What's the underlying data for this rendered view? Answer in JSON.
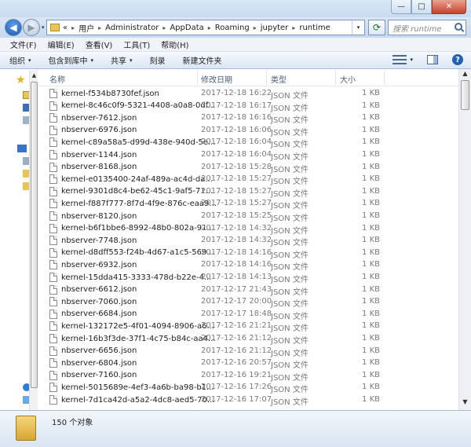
{
  "window": {
    "title": "",
    "min_glyph": "—",
    "max_glyph": "□",
    "close_glyph": "✕"
  },
  "nav": {
    "back_glyph": "◀",
    "forward_glyph": "▶",
    "history_glyph": "▾",
    "refresh_glyph": "⟳",
    "breadcrumbs": [
      "«",
      "用户",
      "Administrator",
      "AppData",
      "Roaming",
      "jupyter",
      "runtime"
    ],
    "separator": "▸",
    "search_placeholder": "搜索 runtime"
  },
  "menu": [
    "文件(F)",
    "编辑(E)",
    "查看(V)",
    "工具(T)",
    "帮助(H)"
  ],
  "toolbar": {
    "items": [
      {
        "label": "组织",
        "dropdown": true
      },
      {
        "label": "包含到库中",
        "dropdown": true
      },
      {
        "label": "共享",
        "dropdown": true
      },
      {
        "label": "刻录",
        "dropdown": false
      },
      {
        "label": "新建文件夹",
        "dropdown": false
      }
    ],
    "dropdown_glyph": "▾",
    "help_glyph": "?"
  },
  "columns": [
    "名称",
    "修改日期",
    "类型",
    "大小"
  ],
  "files": [
    {
      "name": "kernel-f534b8730fef.json",
      "date": "2017-12-18 16:22",
      "type": "JSON 文件",
      "size": "1 KB"
    },
    {
      "name": "kernel-8c46c0f9-5321-4408-a0a8-0df...",
      "date": "2017-12-18 16:17",
      "type": "JSON 文件",
      "size": "1 KB"
    },
    {
      "name": "nbserver-7612.json",
      "date": "2017-12-18 16:16",
      "type": "JSON 文件",
      "size": "1 KB"
    },
    {
      "name": "nbserver-6976.json",
      "date": "2017-12-18 16:06",
      "type": "JSON 文件",
      "size": "1 KB"
    },
    {
      "name": "kernel-c89a58a5-d99d-438e-940d-5e...",
      "date": "2017-12-18 16:04",
      "type": "JSON 文件",
      "size": "1 KB"
    },
    {
      "name": "nbserver-1144.json",
      "date": "2017-12-18 16:04",
      "type": "JSON 文件",
      "size": "1 KB"
    },
    {
      "name": "nbserver-8168.json",
      "date": "2017-12-18 15:28",
      "type": "JSON 文件",
      "size": "1 KB"
    },
    {
      "name": "kernel-e0135400-24af-489a-ac4d-da...",
      "date": "2017-12-18 15:27",
      "type": "JSON 文件",
      "size": "1 KB"
    },
    {
      "name": "kernel-9301d8c4-be62-45c1-9af5-71...",
      "date": "2017-12-18 15:27",
      "type": "JSON 文件",
      "size": "1 KB"
    },
    {
      "name": "kernel-f887f777-8f7d-4f9e-876c-eaa9...",
      "date": "2017-12-18 15:27",
      "type": "JSON 文件",
      "size": "1 KB"
    },
    {
      "name": "nbserver-8120.json",
      "date": "2017-12-18 15:25",
      "type": "JSON 文件",
      "size": "1 KB"
    },
    {
      "name": "kernel-b6f1bbe6-8992-48b0-802a-91...",
      "date": "2017-12-18 14:32",
      "type": "JSON 文件",
      "size": "1 KB"
    },
    {
      "name": "nbserver-7748.json",
      "date": "2017-12-18 14:32",
      "type": "JSON 文件",
      "size": "1 KB"
    },
    {
      "name": "kernel-d8dff553-f24b-4d67-a1c5-569...",
      "date": "2017-12-18 14:16",
      "type": "JSON 文件",
      "size": "1 KB"
    },
    {
      "name": "nbserver-6932.json",
      "date": "2017-12-18 14:16",
      "type": "JSON 文件",
      "size": "1 KB"
    },
    {
      "name": "kernel-15dda415-3333-478d-b22e-4...",
      "date": "2017-12-18 14:13",
      "type": "JSON 文件",
      "size": "1 KB"
    },
    {
      "name": "nbserver-6612.json",
      "date": "2017-12-17 21:43",
      "type": "JSON 文件",
      "size": "1 KB"
    },
    {
      "name": "nbserver-7060.json",
      "date": "2017-12-17 20:00",
      "type": "JSON 文件",
      "size": "1 KB"
    },
    {
      "name": "nbserver-6684.json",
      "date": "2017-12-17 18:48",
      "type": "JSON 文件",
      "size": "1 KB"
    },
    {
      "name": "kernel-132172e5-4f01-4094-8906-a6...",
      "date": "2017-12-16 21:21",
      "type": "JSON 文件",
      "size": "1 KB"
    },
    {
      "name": "kernel-16b3f3de-37f1-4c75-b84c-aa4...",
      "date": "2017-12-16 21:12",
      "type": "JSON 文件",
      "size": "1 KB"
    },
    {
      "name": "nbserver-6656.json",
      "date": "2017-12-16 21:12",
      "type": "JSON 文件",
      "size": "1 KB"
    },
    {
      "name": "nbserver-6804.json",
      "date": "2017-12-16 20:57",
      "type": "JSON 文件",
      "size": "1 KB"
    },
    {
      "name": "nbserver-7160.json",
      "date": "2017-12-16 19:21",
      "type": "JSON 文件",
      "size": "1 KB"
    },
    {
      "name": "kernel-5015689e-4ef3-4a6b-ba98-b1...",
      "date": "2017-12-16 17:26",
      "type": "JSON 文件",
      "size": "1 KB"
    },
    {
      "name": "kernel-7d1ca42d-a5a2-4dc8-aed5-70...",
      "date": "2017-12-16 17:07",
      "type": "JSON 文件",
      "size": "1 KB"
    }
  ],
  "status": {
    "item_count": "150 个对象"
  },
  "scroll": {
    "up_glyph": "▲",
    "down_glyph": "▼"
  }
}
